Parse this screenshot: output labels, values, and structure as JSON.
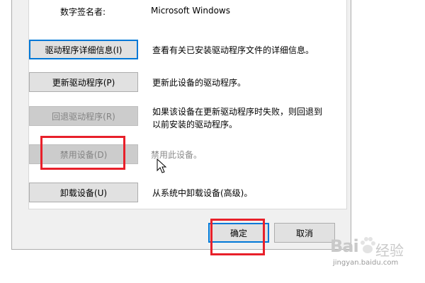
{
  "signer": {
    "label": "数字签名者:",
    "value": "Microsoft Windows"
  },
  "actions": [
    {
      "button": "驱动程序详细信息(I)",
      "description": "查看有关已安装驱动程序文件的详细信息。",
      "enabled": true,
      "focused": true
    },
    {
      "button": "更新驱动程序(P)",
      "description": "更新此设备的驱动程序。",
      "enabled": true,
      "focused": false
    },
    {
      "button": "回退驱动程序(R)",
      "description_line1": "如果该设备在更新驱动程序时失败，则回退到",
      "description_line2": "以前安装的驱动程序。",
      "enabled": false,
      "focused": false
    },
    {
      "button": "禁用设备(D)",
      "description": "禁用此设备。",
      "enabled": false,
      "focused": false,
      "highlighted": true
    },
    {
      "button": "卸载设备(U)",
      "description": "从系统中卸载设备(高级)。",
      "enabled": true,
      "focused": false
    }
  ],
  "dialog_buttons": {
    "ok": "确定",
    "cancel": "取消",
    "ok_highlighted": true
  },
  "watermark": {
    "brand": "Bai",
    "brand_cn": "经验",
    "url": "jingyan.baidu.com"
  },
  "colors": {
    "highlight_box": "#e8202a",
    "focus": "#0078d7",
    "button_bg": "#e1e1e1",
    "disabled_text": "#838383"
  }
}
